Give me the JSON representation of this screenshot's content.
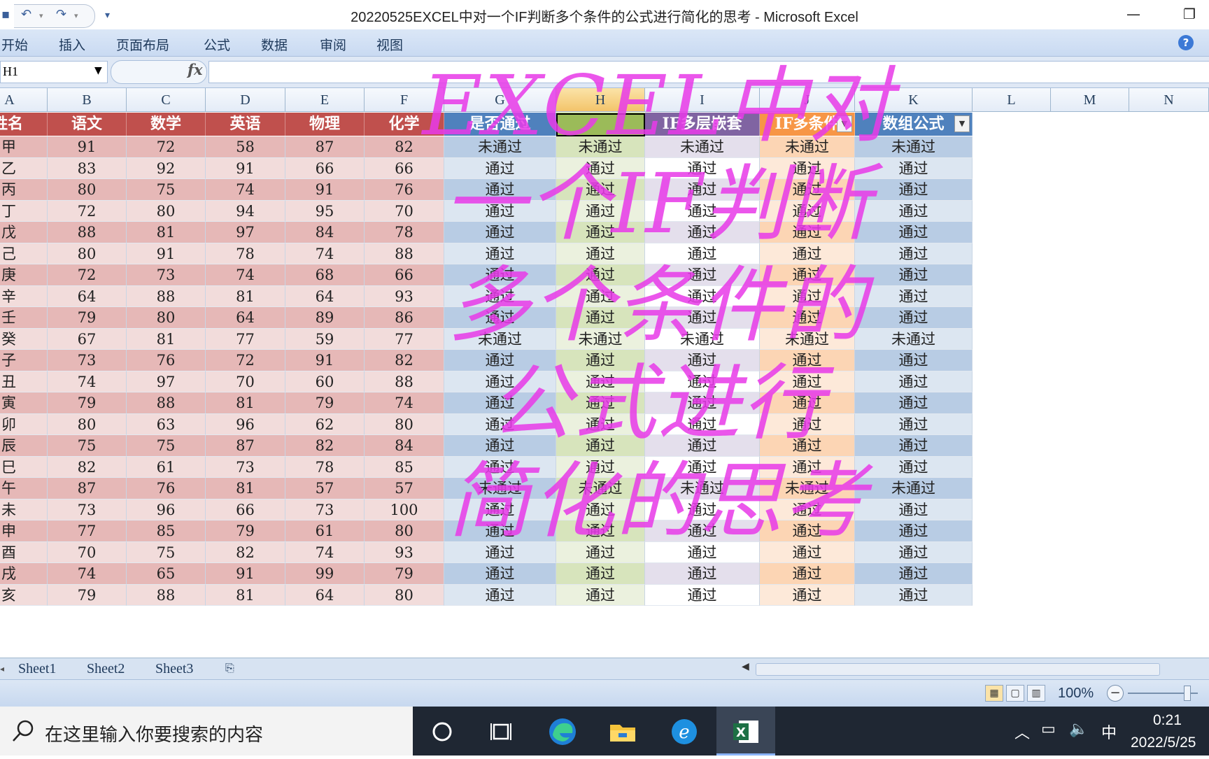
{
  "window": {
    "title": "20220525EXCEL中对一个IF判断多个条件的公式进行简化的思考 - Microsoft Excel",
    "minimize_glyph": "—",
    "restore_glyph": "❐"
  },
  "qat": {
    "save_icon": "save-icon",
    "undo_icon": "undo-icon",
    "redo_icon": "redo-icon",
    "customize_icon": "chevron-down-icon"
  },
  "ribbon": {
    "tabs": [
      "开始",
      "插入",
      "页面布局",
      "公式",
      "数据",
      "审阅",
      "视图"
    ],
    "help_glyph": "?"
  },
  "formula_bar": {
    "name_box": "H1",
    "fx_label": "fx",
    "formula": ""
  },
  "columns": [
    "A",
    "B",
    "C",
    "D",
    "E",
    "F",
    "G",
    "H",
    "I",
    "J",
    "K",
    "L",
    "M",
    "N"
  ],
  "header_row": [
    "姓名",
    "语文",
    "数学",
    "英语",
    "物理",
    "化学",
    "是否通过",
    "",
    "IF多层嵌套",
    "IF多条件",
    "数组公式"
  ],
  "rows": [
    [
      "甲",
      "91",
      "72",
      "58",
      "87",
      "82",
      "未通过",
      "未通过",
      "未通过",
      "未通过",
      "未通过"
    ],
    [
      "乙",
      "83",
      "92",
      "91",
      "66",
      "66",
      "通过",
      "通过",
      "通过",
      "通过",
      "通过"
    ],
    [
      "丙",
      "80",
      "75",
      "74",
      "91",
      "76",
      "通过",
      "通过",
      "通过",
      "通过",
      "通过"
    ],
    [
      "丁",
      "72",
      "80",
      "94",
      "95",
      "70",
      "通过",
      "通过",
      "通过",
      "通过",
      "通过"
    ],
    [
      "戊",
      "88",
      "81",
      "97",
      "84",
      "78",
      "通过",
      "通过",
      "通过",
      "通过",
      "通过"
    ],
    [
      "己",
      "80",
      "91",
      "78",
      "74",
      "88",
      "通过",
      "通过",
      "通过",
      "通过",
      "通过"
    ],
    [
      "庚",
      "72",
      "73",
      "74",
      "68",
      "66",
      "通过",
      "通过",
      "通过",
      "通过",
      "通过"
    ],
    [
      "辛",
      "64",
      "88",
      "81",
      "64",
      "93",
      "通过",
      "通过",
      "通过",
      "通过",
      "通过"
    ],
    [
      "壬",
      "79",
      "80",
      "64",
      "89",
      "86",
      "通过",
      "通过",
      "通过",
      "通过",
      "通过"
    ],
    [
      "癸",
      "67",
      "81",
      "77",
      "59",
      "77",
      "未通过",
      "未通过",
      "未通过",
      "未通过",
      "未通过"
    ],
    [
      "子",
      "73",
      "76",
      "72",
      "91",
      "82",
      "通过",
      "通过",
      "通过",
      "通过",
      "通过"
    ],
    [
      "丑",
      "74",
      "97",
      "70",
      "60",
      "88",
      "通过",
      "通过",
      "通过",
      "通过",
      "通过"
    ],
    [
      "寅",
      "79",
      "88",
      "81",
      "79",
      "74",
      "通过",
      "通过",
      "通过",
      "通过",
      "通过"
    ],
    [
      "卯",
      "80",
      "63",
      "96",
      "62",
      "80",
      "通过",
      "通过",
      "通过",
      "通过",
      "通过"
    ],
    [
      "辰",
      "75",
      "75",
      "87",
      "82",
      "84",
      "通过",
      "通过",
      "通过",
      "通过",
      "通过"
    ],
    [
      "巳",
      "82",
      "61",
      "73",
      "78",
      "85",
      "通过",
      "通过",
      "通过",
      "通过",
      "通过"
    ],
    [
      "午",
      "87",
      "76",
      "81",
      "57",
      "57",
      "未通过",
      "未通过",
      "未通过",
      "未通过",
      "未通过"
    ],
    [
      "未",
      "73",
      "96",
      "66",
      "73",
      "100",
      "通过",
      "通过",
      "通过",
      "通过",
      "通过"
    ],
    [
      "申",
      "77",
      "85",
      "79",
      "61",
      "80",
      "通过",
      "通过",
      "通过",
      "通过",
      "通过"
    ],
    [
      "酉",
      "70",
      "75",
      "82",
      "74",
      "93",
      "通过",
      "通过",
      "通过",
      "通过",
      "通过"
    ],
    [
      "戌",
      "74",
      "65",
      "91",
      "99",
      "79",
      "通过",
      "通过",
      "通过",
      "通过",
      "通过"
    ],
    [
      "亥",
      "79",
      "88",
      "81",
      "64",
      "80",
      "通过",
      "通过",
      "通过",
      "通过",
      "通过"
    ]
  ],
  "overlay": {
    "lines": [
      "EXCEL中对",
      "一个IF判断",
      "多个条件的",
      "公式进行",
      "简化的思考"
    ],
    "color": "#e83ae8"
  },
  "sheets": [
    "Sheet1",
    "Sheet2",
    "Sheet3"
  ],
  "status": {
    "zoom": "100%"
  },
  "taskbar": {
    "search_placeholder": "在这里输入你要搜索的内容",
    "ime": "中",
    "time": "0:21",
    "date": "2022/5/25"
  },
  "colors": {
    "name_header": "#c0504d",
    "G_header": "#4f81bd",
    "H_header": "#9bbb59",
    "I_header": "#8064a2",
    "J_header": "#f79646",
    "K_header": "#4f81bd"
  }
}
